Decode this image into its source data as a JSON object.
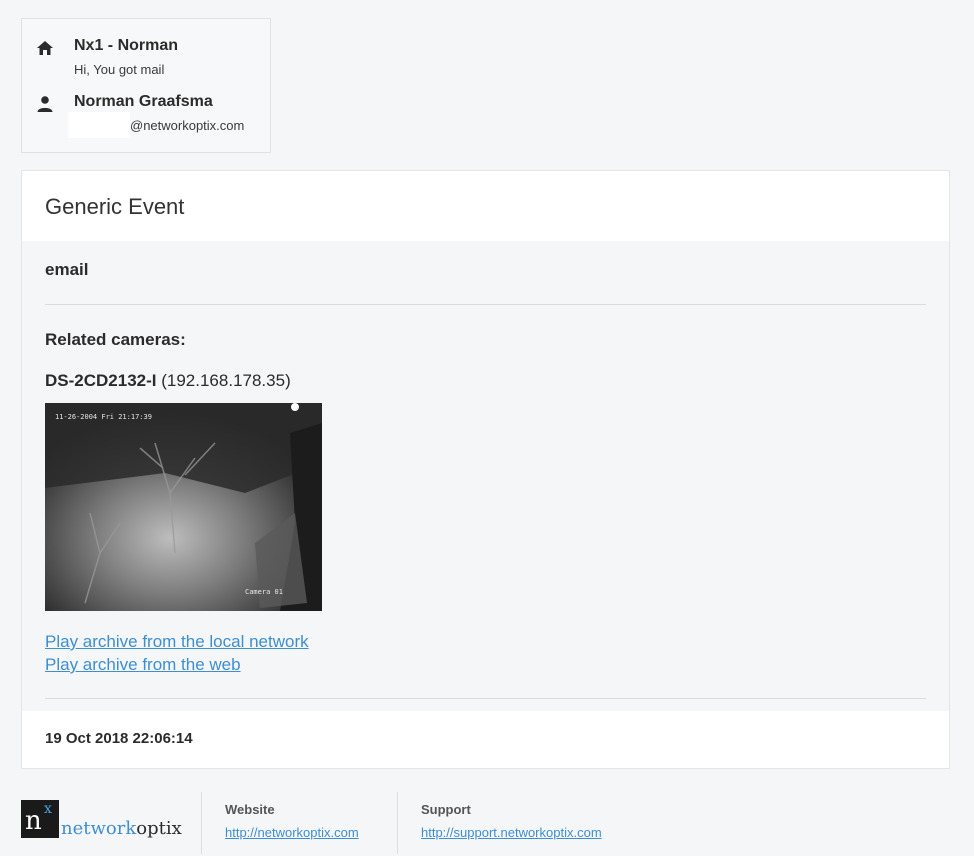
{
  "header": {
    "system": {
      "icon": "home-icon",
      "title": "Nx1 - Norman",
      "message": "Hi, You got mail"
    },
    "user": {
      "icon": "person-icon",
      "name": "Norman Graafsma",
      "email_domain": "@networkoptix.com"
    }
  },
  "event": {
    "title": "Generic Event",
    "caption": "email",
    "related_label": "Related cameras:",
    "camera": {
      "name": "DS-2CD2132-I",
      "address": "(192.168.178.35)"
    },
    "snapshot": {
      "overlay_timestamp": "11-26-2004 Fri 21:17:39",
      "overlay_camera": "Camera 01"
    },
    "links": {
      "local": "Play archive from the local network",
      "web": "Play archive from the web"
    },
    "timestamp": "19 Oct 2018 22:06:14"
  },
  "footer": {
    "logo": {
      "mark_n": "n",
      "mark_x": "x",
      "word_accent": "network",
      "word_rest": "optix"
    },
    "website": {
      "label": "Website",
      "url": "http://networkoptix.com"
    },
    "support": {
      "label": "Support",
      "url": "http://support.networkoptix.com"
    }
  },
  "colors": {
    "link": "#3d8fd1",
    "background": "#f5f6f8",
    "card": "#ffffff"
  }
}
